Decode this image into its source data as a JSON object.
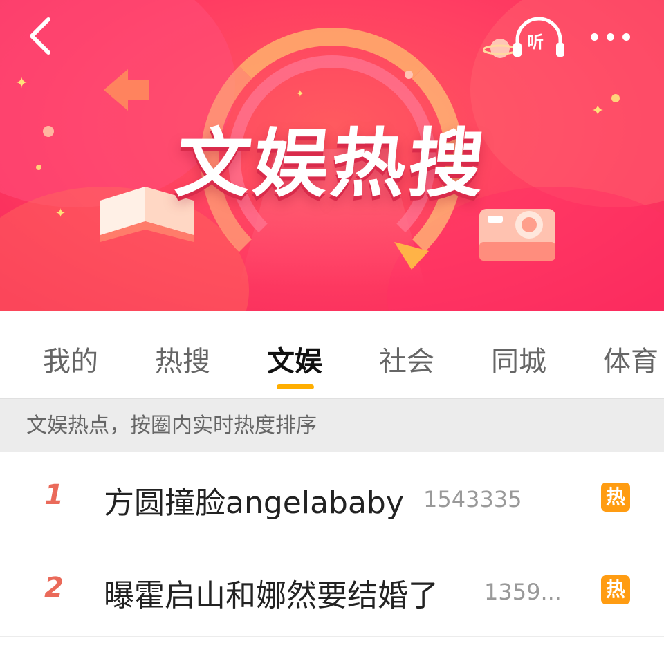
{
  "header": {
    "banner_title": "文娱热搜",
    "listen_label": "听"
  },
  "icons": {
    "back": "chevron-left-icon",
    "listen": "headphones-icon",
    "more": "more-dots-icon"
  },
  "colors": {
    "banner_primary": "#ff3d62",
    "tab_indicator": "#ffae00",
    "rank_color": "#ea6a5a",
    "hot_badge": "#ff9c12"
  },
  "tabs": [
    {
      "label": "我的",
      "active": false
    },
    {
      "label": "热搜",
      "active": false
    },
    {
      "label": "文娱",
      "active": true
    },
    {
      "label": "社会",
      "active": false
    },
    {
      "label": "同城",
      "active": false
    },
    {
      "label": "体育",
      "active": false
    }
  ],
  "hint": "文娱热点，按圈内实时热度排序",
  "items": [
    {
      "rank": "1",
      "title": "方圆撞脸angelababy",
      "count": "1543335",
      "badge": "热"
    },
    {
      "rank": "2",
      "title": "曝霍启山和娜然要结婚了",
      "count": "1359...",
      "badge": "热"
    }
  ]
}
